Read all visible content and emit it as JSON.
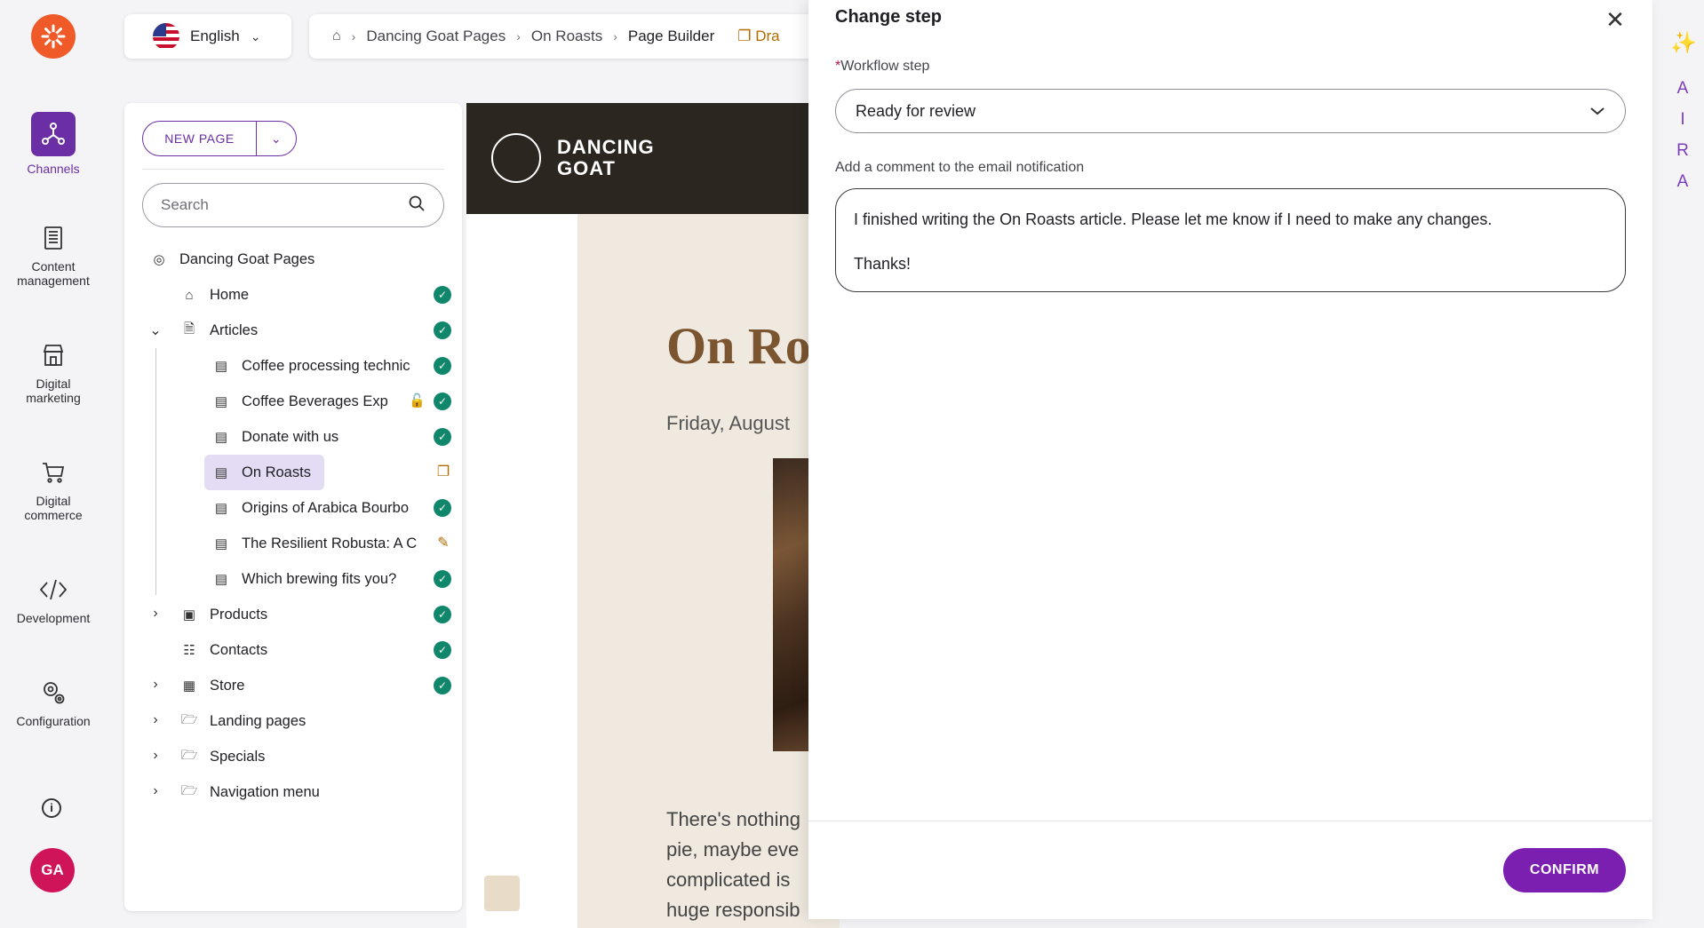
{
  "nav": {
    "items": [
      {
        "label": "Channels",
        "icon": "channels-icon"
      },
      {
        "label": "Content management",
        "line1": "Content",
        "line2": "management",
        "icon": "content-management-icon"
      },
      {
        "label": "Digital marketing",
        "line1": "Digital",
        "line2": "marketing",
        "icon": "digital-marketing-icon"
      },
      {
        "label": "Digital commerce",
        "line1": "Digital",
        "line2": "commerce",
        "icon": "cart-icon"
      },
      {
        "label": "Development",
        "icon": "code-icon"
      },
      {
        "label": "Configuration",
        "icon": "gear-icon"
      }
    ],
    "avatar": "GA",
    "accent": "#6b2ea5"
  },
  "topbar": {
    "language": "English",
    "breadcrumbs": [
      "Dancing Goat Pages",
      "On Roasts",
      "Page Builder"
    ],
    "draft": "Dra"
  },
  "tree": {
    "new_page": "NEW PAGE",
    "search_placeholder": "Search",
    "root": "Dancing Goat Pages",
    "items": [
      {
        "label": "Home"
      },
      {
        "label": "Articles"
      },
      {
        "label": "Coffee processing technic"
      },
      {
        "label": "Coffee Beverages Exp"
      },
      {
        "label": "Donate with us"
      },
      {
        "label": "On Roasts"
      },
      {
        "label": "Origins of Arabica Bourbo"
      },
      {
        "label": "The Resilient Robusta: A C"
      },
      {
        "label": "Which brewing fits you?"
      },
      {
        "label": "Products"
      },
      {
        "label": "Contacts"
      },
      {
        "label": "Store"
      },
      {
        "label": "Landing pages"
      },
      {
        "label": "Specials"
      },
      {
        "label": "Navigation menu"
      }
    ],
    "status_color": "#10866b"
  },
  "preview": {
    "brand_line1": "DANCING",
    "brand_line2": "GOAT",
    "title": "On Ro",
    "date": "Friday, August",
    "body": [
      "There's nothing",
      "pie, maybe eve",
      "complicated is",
      "huge responsib"
    ]
  },
  "ai_rail": {
    "letters": [
      "A",
      "I",
      "R",
      "A"
    ]
  },
  "dialog": {
    "title": "Change step",
    "workflow_label": "Workflow step",
    "workflow_value": "Ready for review",
    "comment_label": "Add a comment to the email notification",
    "comment_line1": "I finished writing the On Roasts article. Please let me know if I need to make any changes.",
    "comment_line2": "Thanks!",
    "confirm": "CONFIRM",
    "confirm_color": "#7a1fb0"
  }
}
